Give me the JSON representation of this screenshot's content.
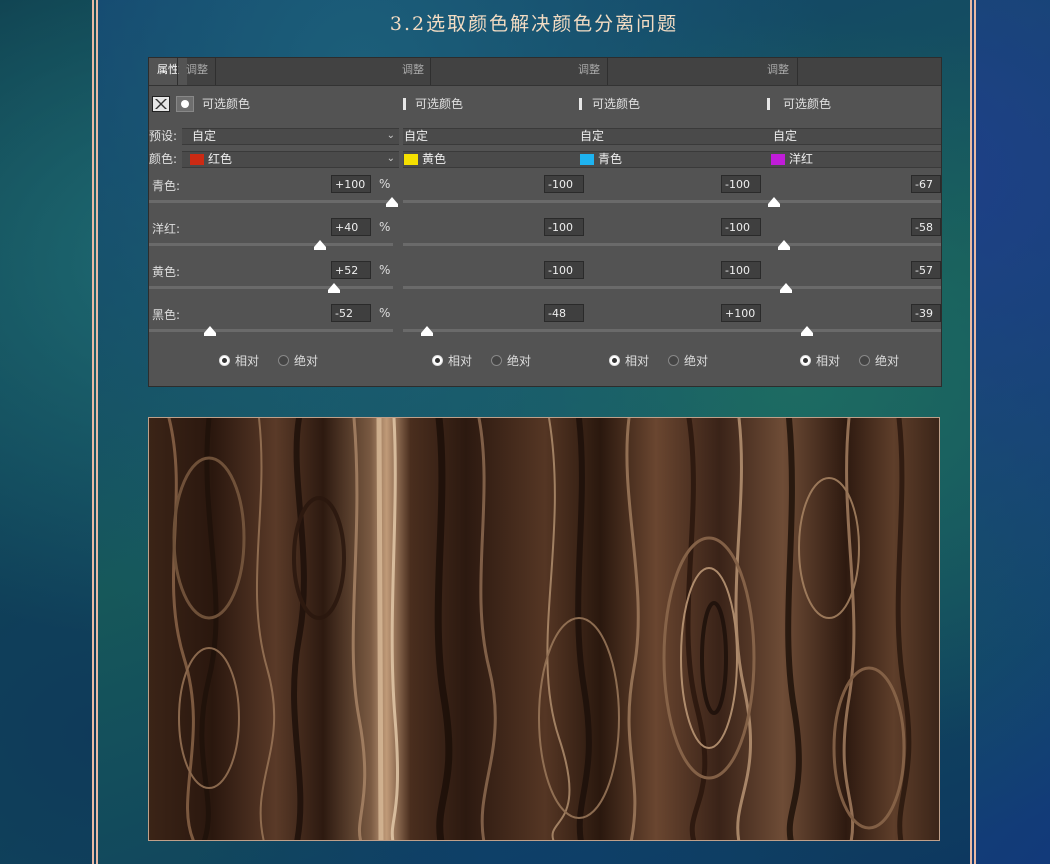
{
  "title": "3.2选取颜色解决颜色分离问题",
  "tabs": {
    "properties": "属性",
    "adjust": "调整"
  },
  "panels": [
    {
      "header": "可选颜色",
      "preset": "自定",
      "color_name": "红色",
      "swatch": "#cc2a13",
      "cyan": "+100",
      "magenta": "+40",
      "yellow": "+52",
      "black": "-52",
      "levels": {
        "cyan": 1.0,
        "magenta": 0.7,
        "yellow": 0.76,
        "black": 0.24
      }
    },
    {
      "header": "可选颜色",
      "preset": "自定",
      "color_name": "黄色",
      "swatch": "#f5e000",
      "cyan": "-100",
      "magenta": "-100",
      "yellow": "-100",
      "black": "-48",
      "levels": {
        "cyan": 0.0,
        "magenta": 0.0,
        "yellow": 0.0,
        "black": 0.26
      }
    },
    {
      "header": "可选颜色",
      "preset": "自定",
      "color_name": "青色",
      "swatch": "#1eb3f0",
      "cyan": "-100",
      "magenta": "-100",
      "yellow": "-100",
      "black": "+100",
      "levels": {
        "cyan": 0.0,
        "magenta": 0.0,
        "yellow": 0.0,
        "black": 1.0
      }
    },
    {
      "header": "可选颜色",
      "preset": "自定",
      "color_name": "洋红",
      "swatch": "#c01cd8",
      "cyan": "-67",
      "magenta": "-58",
      "yellow": "-57",
      "black": "-39",
      "levels": {
        "cyan": 0.17,
        "magenta": 0.21,
        "yellow": 0.22,
        "black": 0.31
      }
    }
  ],
  "labels": {
    "preset": "预设:",
    "color": "颜色:",
    "cyan": "青色:",
    "magenta": "洋红:",
    "yellow": "黄色:",
    "black": "黑色:",
    "percent": "%",
    "relative": "相对",
    "absolute": "绝对"
  }
}
